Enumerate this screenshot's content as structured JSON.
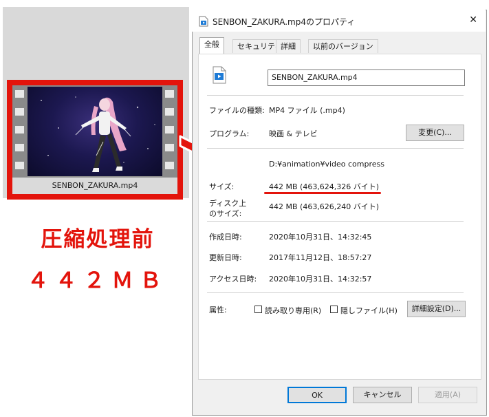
{
  "thumbnail": {
    "caption": "SENBON_ZAKURA.mp4"
  },
  "annotation": {
    "line1": "圧縮処理前",
    "line2": "４４２ＭＢ",
    "accent": "#e3140c"
  },
  "dialog": {
    "title": "SENBON_ZAKURA.mp4のプロパティ",
    "close_glyph": "✕",
    "tabs": [
      "全般",
      "セキュリティ",
      "詳細",
      "以前のバージョン"
    ],
    "filename": "SENBON_ZAKURA.mp4",
    "rows": {
      "type_label": "ファイルの種類:",
      "type_value": "MP4 ファイル (.mp4)",
      "program_label": "プログラム:",
      "program_value": "映画 & テレビ",
      "change_button": "変更(C)...",
      "location_value": "D:¥animation¥video compress",
      "size_label": "サイズ:",
      "size_value": "442 MB (463,624,326 バイト)",
      "disk_label_1": "ディスク上",
      "disk_label_2": "のサイズ:",
      "disk_value": "442 MB (463,626,240 バイト)",
      "created_label": "作成日時:",
      "created_value": "2020年10月31日、14:32:45",
      "modified_label": "更新日時:",
      "modified_value": "2017年11月12日、18:57:27",
      "accessed_label": "アクセス日時:",
      "accessed_value": "2020年10月31日、14:32:57",
      "attr_label": "属性:",
      "readonly_label": "読み取り専用(R)",
      "hidden_label": "隠しファイル(H)",
      "advanced_button": "詳細設定(D)..."
    },
    "buttons": {
      "ok": "OK",
      "cancel": "キャンセル",
      "apply": "適用(A)"
    }
  }
}
